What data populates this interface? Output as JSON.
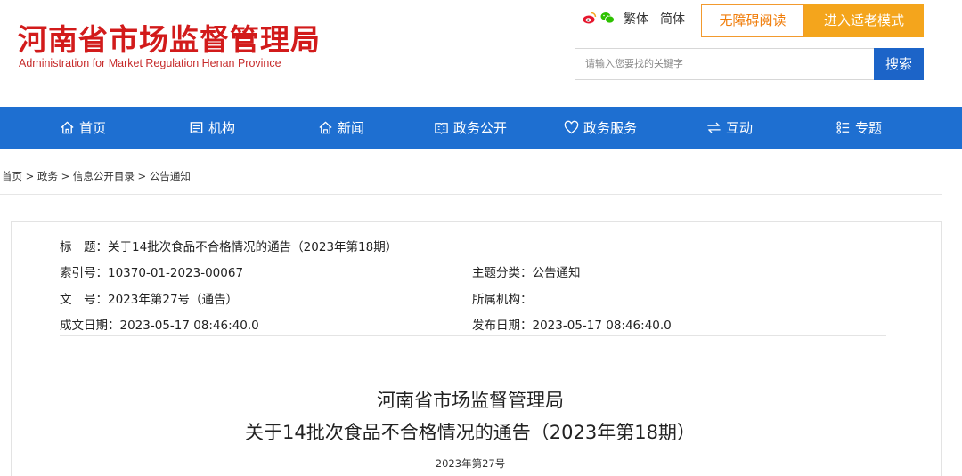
{
  "header": {
    "logo_cn": "河南省市场监督管理局",
    "logo_en": "Administration for Market Regulation Henan Province",
    "social_icons": [
      "weibo-icon",
      "wechat-icon"
    ],
    "lang_traditional": "繁体",
    "lang_simplified": "简体",
    "accessible_reading": "无障碍阅读",
    "elder_mode": "进入适老模式",
    "search_placeholder": "请输入您要找的关键字",
    "search_button": "搜索"
  },
  "nav": {
    "items": [
      {
        "label": "首页",
        "icon": "home-icon"
      },
      {
        "label": "机构",
        "icon": "organization-icon"
      },
      {
        "label": "新闻",
        "icon": "news-icon"
      },
      {
        "label": "政务公开",
        "icon": "open-government-icon"
      },
      {
        "label": "政务服务",
        "icon": "heart-service-icon"
      },
      {
        "label": "互动",
        "icon": "exchange-icon"
      },
      {
        "label": "专题",
        "icon": "topic-list-icon"
      }
    ]
  },
  "breadcrumb": "首页 > 政务 > 信息公开目录 > 公告通知",
  "info": {
    "title": "标　题：关于14批次食品不合格情况的通告（2023年第18期）",
    "index": "索引号：10370-01-2023-00067",
    "category": "主题分类：公告通知",
    "doc_no": "文　号：2023年第27号（通告）",
    "agency": "所属机构：",
    "created": "成文日期：2023-05-17 08:46:40.0",
    "published": "发布日期：2023-05-17 08:46:40.0"
  },
  "document": {
    "title_line1": "河南省市场监督管理局",
    "title_line2": "关于14批次食品不合格情况的通告（2023年第18期）",
    "number": "2023年第27号"
  },
  "colors": {
    "brand_red": "#d21b1b",
    "nav_blue": "#1e6fd1",
    "search_blue": "#1c64c8",
    "elder_orange": "#f4a51c",
    "access_orange": "#f07d0a"
  }
}
